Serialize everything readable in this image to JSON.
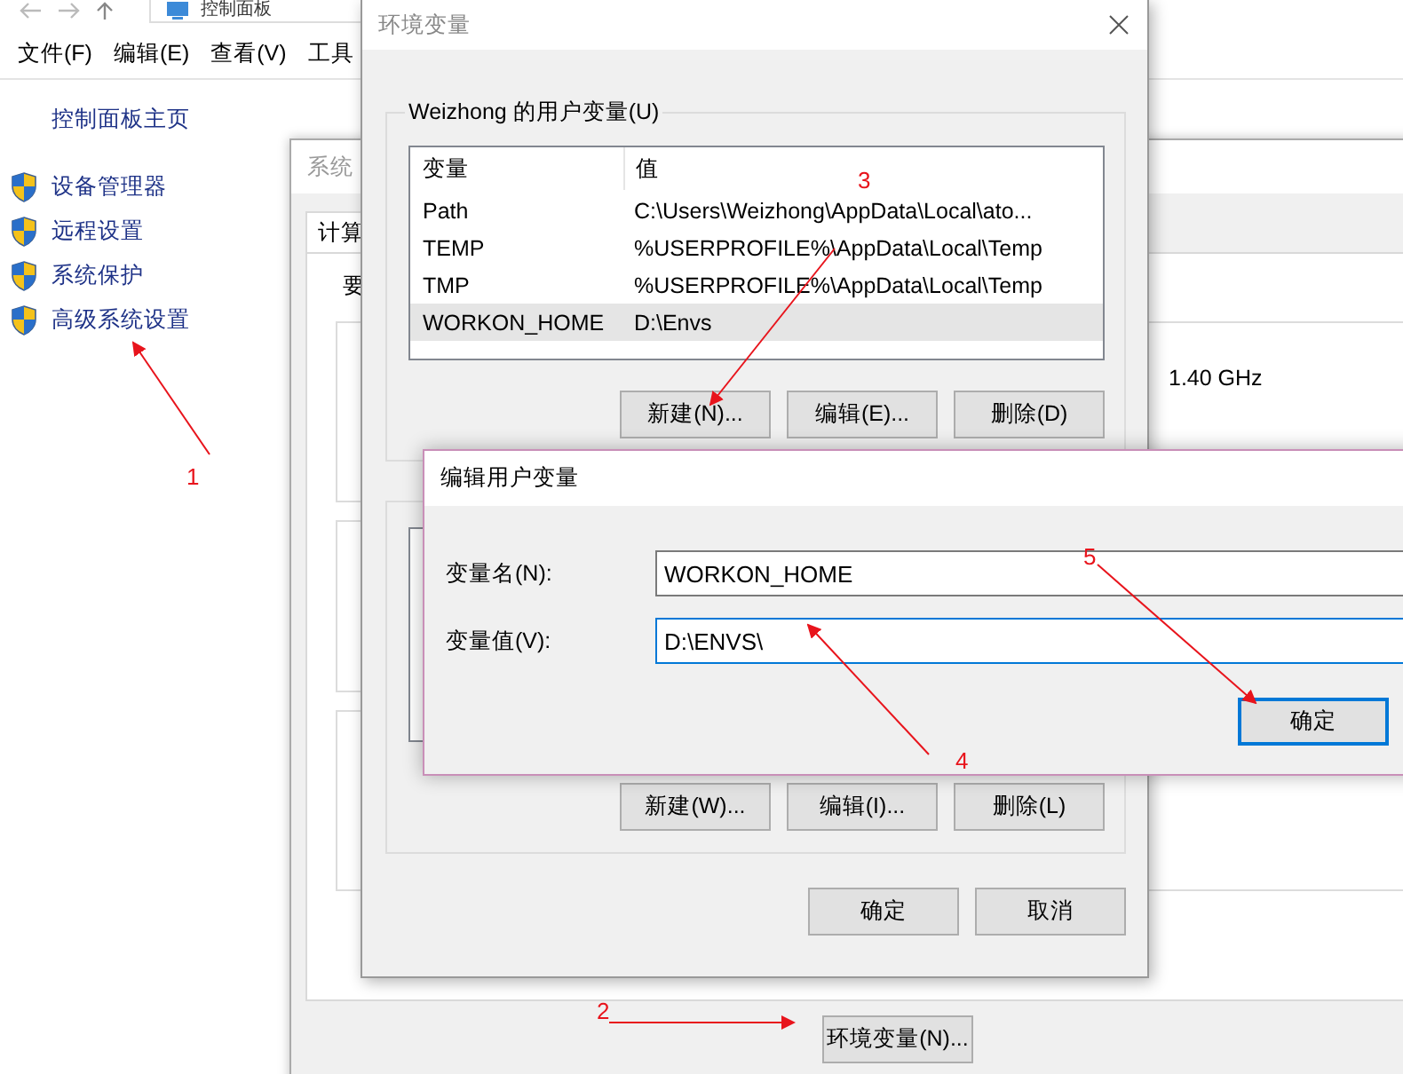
{
  "explorer": {
    "address": "控制面板",
    "menu": [
      "文件(F)",
      "编辑(E)",
      "查看(V)",
      "工具"
    ],
    "home_link": "控制面板主页",
    "tasks": [
      "设备管理器",
      "远程设置",
      "系统保护",
      "高级系统设置"
    ]
  },
  "system_properties": {
    "title": "系统",
    "tab": "计算",
    "intro": "要",
    "speed": "1.40 GHz",
    "env_button": "环境变量(N)..."
  },
  "env_dialog": {
    "title": "环境变量",
    "user_group": "Weizhong 的用户变量(U)",
    "columns": [
      "变量",
      "值"
    ],
    "rows": [
      {
        "name": "Path",
        "value": "C:\\Users\\Weizhong\\AppData\\Local\\ato...",
        "selected": false
      },
      {
        "name": "TEMP",
        "value": "%USERPROFILE%\\AppData\\Local\\Temp",
        "selected": false
      },
      {
        "name": "TMP",
        "value": "%USERPROFILE%\\AppData\\Local\\Temp",
        "selected": false
      },
      {
        "name": "WORKON_HOME",
        "value": "D:\\Envs",
        "selected": true
      }
    ],
    "user_buttons": [
      "新建(N)...",
      "编辑(E)...",
      "删除(D)"
    ],
    "system_buttons": [
      "新建(W)...",
      "编辑(I)...",
      "删除(L)"
    ],
    "buttons": [
      "确定",
      "取消"
    ]
  },
  "edit_dialog": {
    "title": "编辑用户变量",
    "fields": [
      {
        "label": "变量名(N):",
        "value": "WORKON_HOME",
        "focused": false
      },
      {
        "label": "变量值(V):",
        "value": "D:\\ENVS\\",
        "focused": true
      }
    ],
    "ok_button": "确定"
  },
  "annotations": [
    "1",
    "2",
    "3",
    "4",
    "5"
  ]
}
